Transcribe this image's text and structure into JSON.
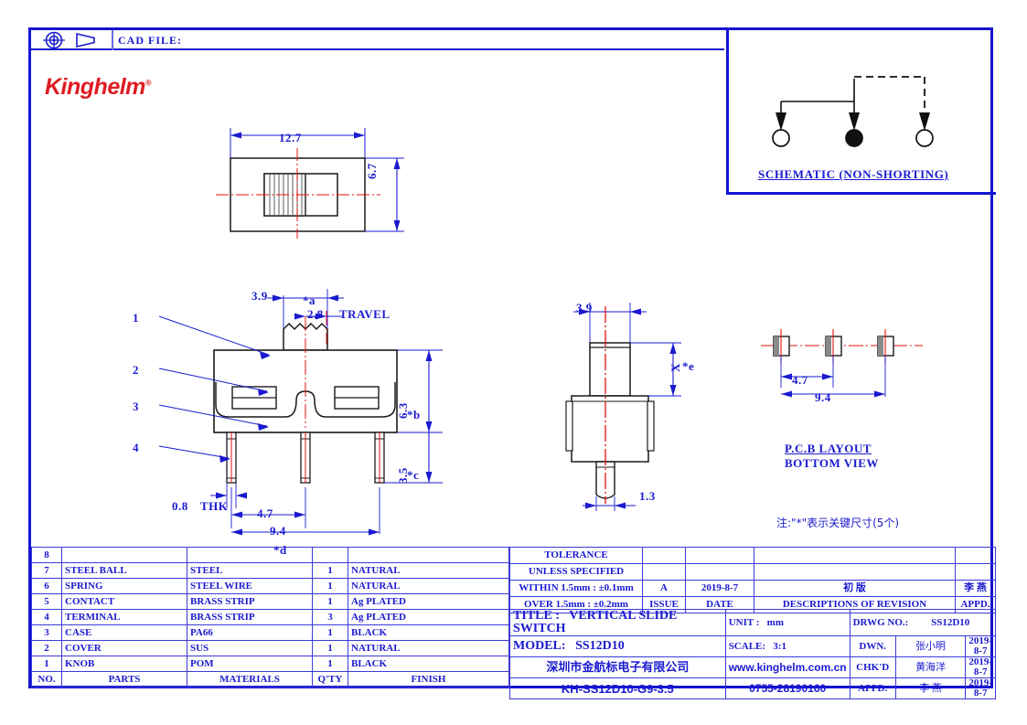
{
  "header": {
    "cad_file_label": "CAD FILE:",
    "cad_file_value": "",
    "brand": "Kinghelm",
    "brand_tm": "®"
  },
  "colors": {
    "line_blue": "#1a1ad0",
    "frame_blue": "#1414d2",
    "brand_red": "#e01b22",
    "centerline_red": "#e81010",
    "part_black": "#1a1a1a"
  },
  "schematic": {
    "caption": "SCHEMATIC (NON-SHORTING)"
  },
  "views": {
    "top_view": {
      "dim_width": "12.7",
      "dim_height": "6.7"
    },
    "front_view": {
      "dim_knob_width": "3.9",
      "dim_travel": "2.8",
      "travel_label": "TRAVEL",
      "key_a": "*a",
      "dim_body_height": "6.3",
      "key_b": "*b",
      "dim_pin_length": "3.5",
      "key_c": "*c",
      "dim_thk": "0.8",
      "thk_label": "THK",
      "dim_pitch": "4.7",
      "dim_span": "9.4",
      "key_d": "*d",
      "callouts": [
        "1",
        "2",
        "3",
        "4"
      ]
    },
    "side_view": {
      "dim_width": "3.9",
      "dim_x": "X",
      "key_e": "*e",
      "dim_pin_width": "1.3"
    },
    "pcb_layout": {
      "dim_pitch": "4.7",
      "dim_span": "9.4",
      "caption_line1": "P.C.B LAYOUT",
      "caption_line2": "BOTTOM VIEW"
    },
    "note": "注:\"*\"表示关键尺寸(5个)"
  },
  "parts_table": {
    "headers": {
      "no": "NO.",
      "parts": "PARTS",
      "materials": "MATERIALS",
      "qty": "Q'TY",
      "finish": "FINISH"
    },
    "rows": [
      {
        "no": "8",
        "part": "",
        "material": "",
        "qty": "",
        "finish": ""
      },
      {
        "no": "7",
        "part": "STEEL BALL",
        "material": "STEEL",
        "qty": "1",
        "finish": "NATURAL"
      },
      {
        "no": "6",
        "part": "SPRING",
        "material": "STEEL WIRE",
        "qty": "1",
        "finish": "NATURAL"
      },
      {
        "no": "5",
        "part": "CONTACT",
        "material": "BRASS STRIP",
        "qty": "1",
        "finish": "Ag PLATED"
      },
      {
        "no": "4",
        "part": "TERMINAL",
        "material": "BRASS STRIP",
        "qty": "3",
        "finish": "Ag PLATED"
      },
      {
        "no": "3",
        "part": "CASE",
        "material": "PA66",
        "qty": "1",
        "finish": "BLACK"
      },
      {
        "no": "2",
        "part": "COVER",
        "material": "SUS",
        "qty": "1",
        "finish": "NATURAL"
      },
      {
        "no": "1",
        "part": "KNOB",
        "material": "POM",
        "qty": "1",
        "finish": "BLACK"
      }
    ]
  },
  "title_block": {
    "tolerance_title_1": "TOLERANCE",
    "tolerance_title_2": "UNLESS SPECIFIED",
    "tolerance_within": "WITHIN 1.5mm : ±0.1mm",
    "tolerance_over": "OVER 1.5mm : ±0.2mm",
    "issue_value": "A",
    "date_value": "2019-8-7",
    "issue_label": "ISSUE",
    "date_label": "DATE",
    "revision_value": "初 版",
    "revision_label": "DESCRIPTIONS OF REVISION",
    "appd_value": "李 燕",
    "appd_label": "APPD.",
    "title_label": "TITLE :",
    "title_value": "VERTICAL SLIDE SWITCH",
    "model_label": "MODEL:",
    "model_value": "SS12D10",
    "company_cn": "深圳市金航标电子有限公司",
    "part_number": "KH-SS12D10-G9-3.5",
    "website": "www.kinghelm.com.cn",
    "phone": "0755-28190160",
    "unit_label": "UNIT :",
    "unit_value": "mm",
    "scale_label": "SCALE:",
    "scale_value": "3:1",
    "drwg_no_label": "DRWG NO.:",
    "drwg_no_value": "SS12D10",
    "dwn_label": "DWN.",
    "dwn_name": "张小明",
    "dwn_date": "2019-8-7",
    "chkd_label": "CHK'D",
    "chkd_name": "黄海洋",
    "chkd_date": "2019-8-7",
    "appd2_label": "APPD.",
    "appd2_name": "李 燕",
    "appd2_date": "2019-8-7"
  }
}
